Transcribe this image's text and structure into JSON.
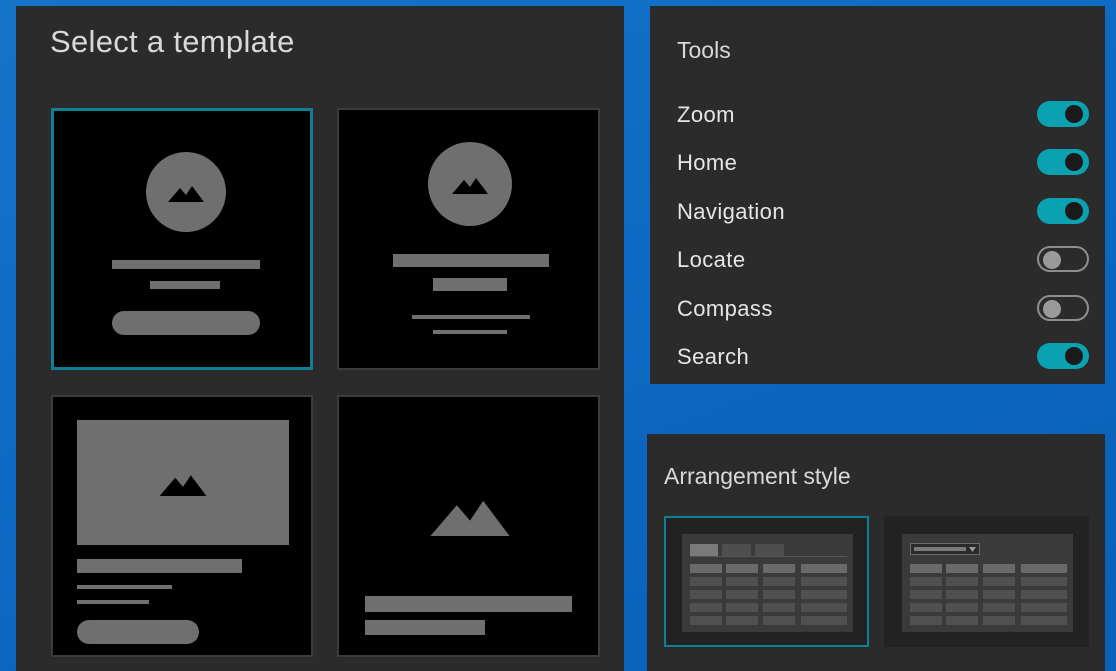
{
  "template_panel": {
    "title": "Select a template",
    "cards": [
      {
        "name": "centered-avatar-card",
        "selected": true
      },
      {
        "name": "centered-text-card",
        "selected": false
      },
      {
        "name": "header-image-card",
        "selected": false
      },
      {
        "name": "bottom-text-card",
        "selected": false
      }
    ]
  },
  "tools_panel": {
    "title": "Tools",
    "items": [
      {
        "label": "Zoom",
        "on": true
      },
      {
        "label": "Home",
        "on": true
      },
      {
        "label": "Navigation",
        "on": true
      },
      {
        "label": "Locate",
        "on": false
      },
      {
        "label": "Compass",
        "on": false
      },
      {
        "label": "Search",
        "on": true
      }
    ]
  },
  "arrangement_panel": {
    "title": "Arrangement style",
    "options": [
      {
        "name": "tabs-layout",
        "selected": true
      },
      {
        "name": "dropdown-layout",
        "selected": false
      }
    ]
  },
  "colors": {
    "accent": "#0aa1b0",
    "selected_border": "#0f7f93",
    "panel_bg": "#2b2b2b",
    "background": "#0d6ac4"
  }
}
